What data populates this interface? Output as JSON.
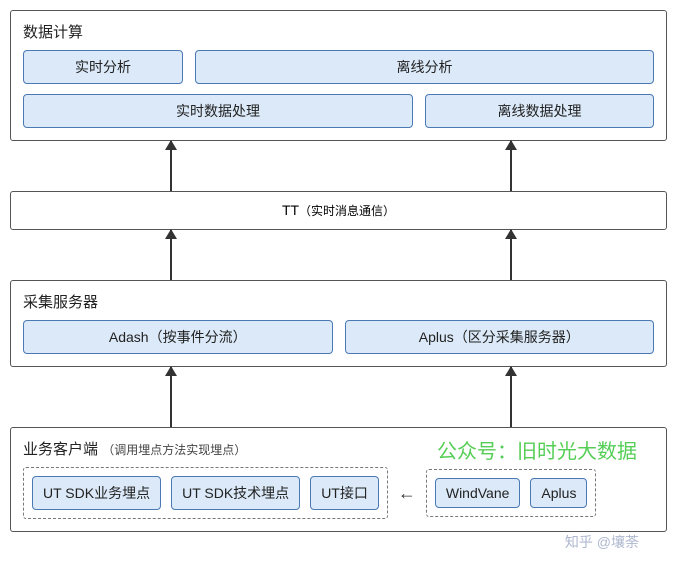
{
  "layers": {
    "compute": {
      "title": "数据计算",
      "row1": {
        "a": "实时分析",
        "b": "离线分析"
      },
      "row2": {
        "a": "实时数据处理",
        "b": "离线数据处理"
      }
    },
    "tt": {
      "main": "TT",
      "sub": "（实时消息通信）"
    },
    "collect": {
      "title": "采集服务器",
      "a": "Adash（按事件分流）",
      "b": "Aplus（区分采集服务器）"
    },
    "client": {
      "title": "业务客户端",
      "sub": "（调用埋点方法实现埋点）",
      "group_a": {
        "n1": "UT SDK业务埋点",
        "n2": "UT SDK技术埋点",
        "n3": "UT接口"
      },
      "arrow": "←",
      "group_b": {
        "n1": "WindVane",
        "n2": "Aplus"
      }
    }
  },
  "watermarks": {
    "w1": "公众号：旧时光大数据",
    "w2": "知乎 @壤荼"
  }
}
